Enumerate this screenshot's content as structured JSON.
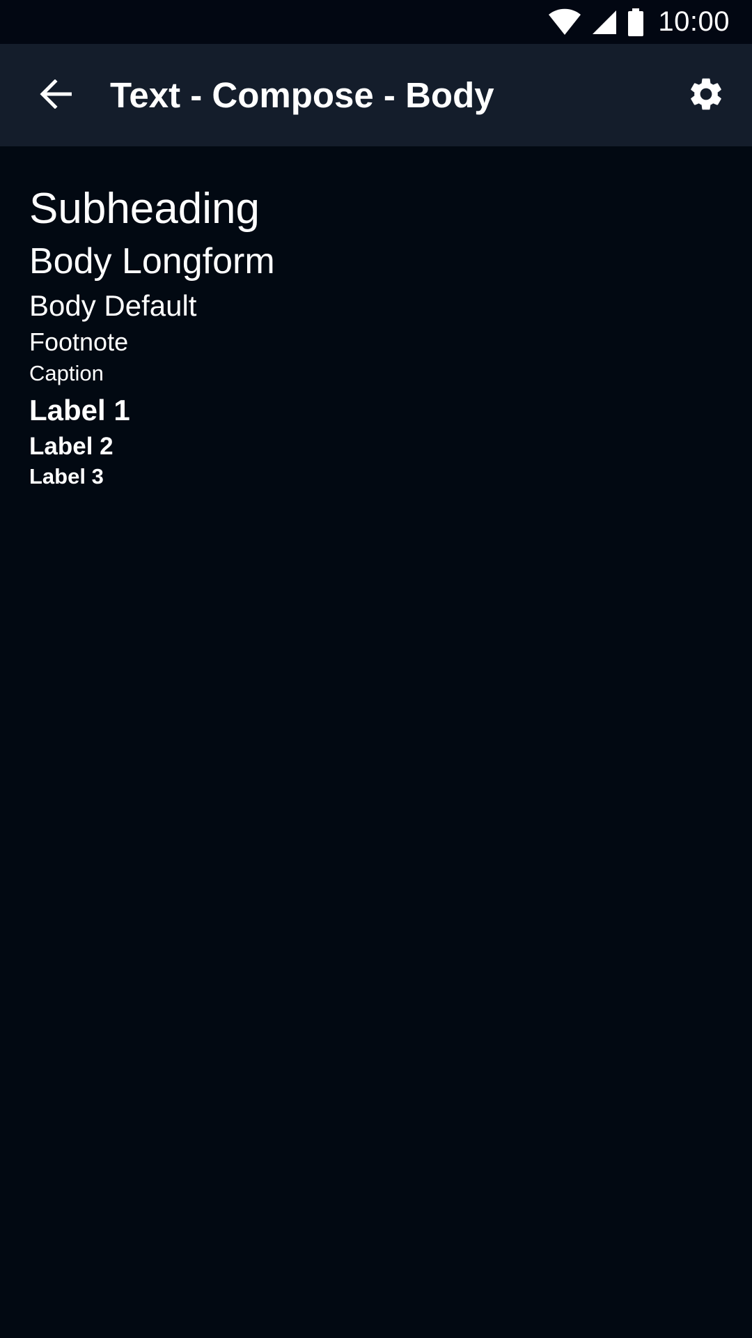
{
  "status_bar": {
    "time": "10:00",
    "icons": [
      "wifi-icon",
      "cellular-signal-icon",
      "battery-icon"
    ]
  },
  "app_bar": {
    "title": "Text - Compose - Body",
    "back_icon": "arrow-back-icon",
    "settings_icon": "gear-icon"
  },
  "content": {
    "subheading": "Subheading",
    "body_longform": "Body Longform",
    "body_default": "Body Default",
    "footnote": "Footnote",
    "caption": "Caption",
    "label_1": "Label 1",
    "label_2": "Label 2",
    "label_3": "Label 3"
  },
  "colors": {
    "background": "#020912",
    "app_bar": "#141d2b",
    "status_bar": "#020712",
    "text": "#ffffff"
  }
}
